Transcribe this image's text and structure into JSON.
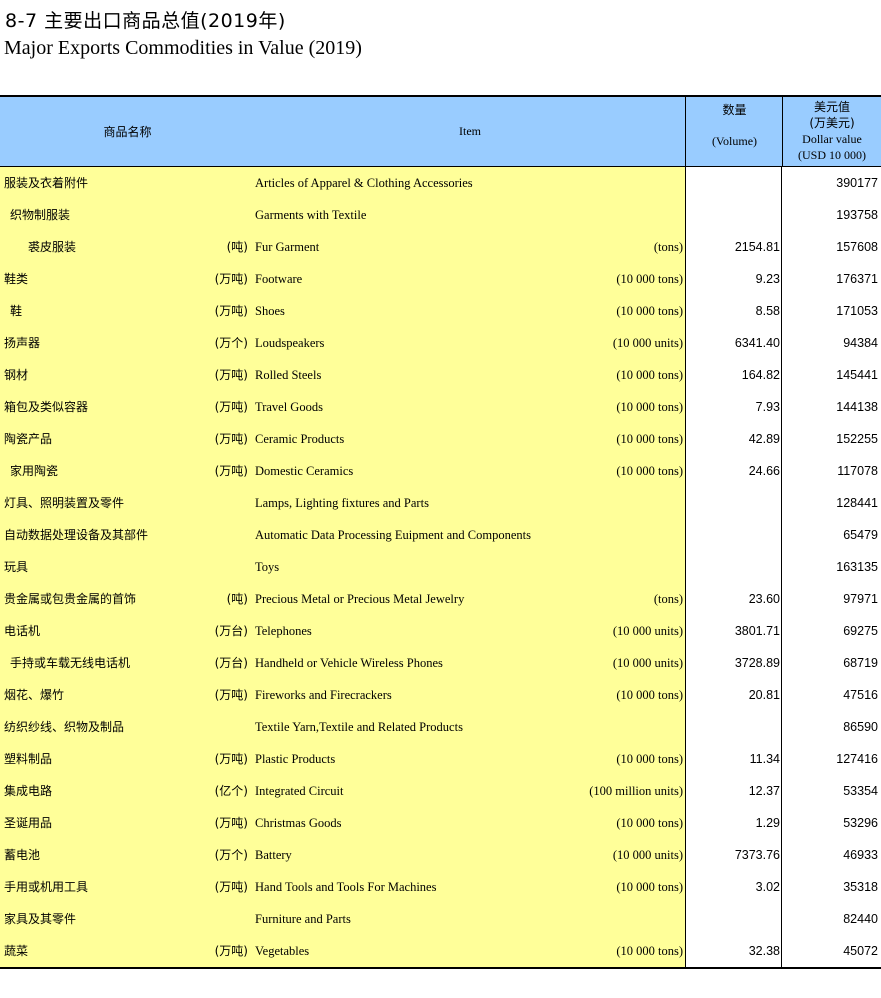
{
  "title_zh": "8-7  主要出口商品总值(2019年)",
  "title_en": "Major Exports Commodities in Value (2019)",
  "header": {
    "name_zh": "商品名称",
    "item_en": "Item",
    "volume_zh": "数量",
    "volume_en": "(Volume)",
    "value_zh_1": "美元值",
    "value_zh_2": "(万美元)",
    "value_en_1": "Dollar value",
    "value_en_2": "(USD 10 000)"
  },
  "rows": [
    {
      "name": "服装及衣着附件",
      "indent": 0,
      "unit_zh": "",
      "item": "Articles of Apparel & Clothing Accessories",
      "unit_en": "",
      "volume": "",
      "value": "390177"
    },
    {
      "name": "织物制服装",
      "indent": 1,
      "unit_zh": "",
      "item": "Garments with Textile",
      "unit_en": "",
      "volume": "",
      "value": "193758"
    },
    {
      "name": "裘皮服装",
      "indent": 2,
      "unit_zh": "(吨)",
      "item": "Fur Garment",
      "unit_en": "(tons)",
      "volume": "2154.81",
      "value": "157608"
    },
    {
      "name": "鞋类",
      "indent": 0,
      "unit_zh": "(万吨)",
      "item": "Footware",
      "unit_en": "(10 000 tons)",
      "volume": "9.23",
      "value": "176371"
    },
    {
      "name": "鞋",
      "indent": 1,
      "unit_zh": "(万吨)",
      "item": "Shoes",
      "unit_en": "(10 000 tons)",
      "volume": "8.58",
      "value": "171053"
    },
    {
      "name": "扬声器",
      "indent": 0,
      "unit_zh": "(万个)",
      "item": "Loudspeakers",
      "unit_en": "(10 000 units)",
      "volume": "6341.40",
      "value": "94384"
    },
    {
      "name": "钢材",
      "indent": 0,
      "unit_zh": "(万吨)",
      "item": "Rolled Steels",
      "unit_en": "(10 000 tons)",
      "volume": "164.82",
      "value": "145441"
    },
    {
      "name": "箱包及类似容器",
      "indent": 0,
      "unit_zh": "(万吨)",
      "item": "Travel Goods",
      "unit_en": "(10 000 tons)",
      "volume": "7.93",
      "value": "144138"
    },
    {
      "name": "陶瓷产品",
      "indent": 0,
      "unit_zh": "(万吨)",
      "item": "Ceramic Products",
      "unit_en": "(10 000 tons)",
      "volume": "42.89",
      "value": "152255"
    },
    {
      "name": "家用陶瓷",
      "indent": 1,
      "unit_zh": "(万吨)",
      "item": "Domestic Ceramics",
      "unit_en": "(10 000 tons)",
      "volume": "24.66",
      "value": "117078"
    },
    {
      "name": "灯具、照明装置及零件",
      "indent": 0,
      "unit_zh": "",
      "item": "Lamps, Lighting fixtures and Parts",
      "unit_en": "",
      "volume": "",
      "value": "128441"
    },
    {
      "name": "自动数据处理设备及其部件",
      "indent": 0,
      "unit_zh": "",
      "item": "Automatic Data Processing Euipment and Components",
      "unit_en": "",
      "volume": "",
      "value": "65479"
    },
    {
      "name": "玩具",
      "indent": 0,
      "unit_zh": "",
      "item": "Toys",
      "unit_en": "",
      "volume": "",
      "value": "163135"
    },
    {
      "name": "贵金属或包贵金属的首饰",
      "indent": 0,
      "unit_zh": "(吨)",
      "item": "Precious Metal or Precious Metal Jewelry",
      "unit_en": "(tons)",
      "volume": "23.60",
      "value": "97971"
    },
    {
      "name": "电话机",
      "indent": 0,
      "unit_zh": "(万台)",
      "item": "Telephones",
      "unit_en": "(10 000 units)",
      "volume": "3801.71",
      "value": "69275"
    },
    {
      "name": "手持或车载无线电话机",
      "indent": 1,
      "unit_zh": "(万台)",
      "item": "Handheld or Vehicle Wireless Phones",
      "unit_en": "(10 000 units)",
      "volume": "3728.89",
      "value": "68719"
    },
    {
      "name": "烟花、爆竹",
      "indent": 0,
      "unit_zh": "(万吨)",
      "item": "Fireworks and Firecrackers",
      "unit_en": "(10 000 tons)",
      "volume": "20.81",
      "value": "47516"
    },
    {
      "name": "纺织纱线、织物及制品",
      "indent": 0,
      "unit_zh": "",
      "item": "Textile Yarn,Textile and Related Products",
      "unit_en": "",
      "volume": "",
      "value": "86590"
    },
    {
      "name": "塑料制品",
      "indent": 0,
      "unit_zh": "(万吨)",
      "item": "Plastic Products",
      "unit_en": "(10 000 tons)",
      "volume": "11.34",
      "value": "127416"
    },
    {
      "name": "集成电路",
      "indent": 0,
      "unit_zh": "(亿个)",
      "item": "Integrated Circuit",
      "unit_en": "(100 million units)",
      "volume": "12.37",
      "value": "53354"
    },
    {
      "name": "圣诞用品",
      "indent": 0,
      "unit_zh": "(万吨)",
      "item": "Christmas Goods",
      "unit_en": "(10 000 tons)",
      "volume": "1.29",
      "value": "53296"
    },
    {
      "name": "蓄电池",
      "indent": 0,
      "unit_zh": "(万个)",
      "item": "Battery",
      "unit_en": "(10 000 units)",
      "volume": "7373.76",
      "value": "46933"
    },
    {
      "name": "手用或机用工具",
      "indent": 0,
      "unit_zh": "(万吨)",
      "item": "Hand Tools and Tools For Machines",
      "unit_en": "(10 000 tons)",
      "volume": "3.02",
      "value": "35318"
    },
    {
      "name": "家具及其零件",
      "indent": 0,
      "unit_zh": "",
      "item": "Furniture and Parts",
      "unit_en": "",
      "volume": "",
      "value": "82440"
    },
    {
      "name": "蔬菜",
      "indent": 0,
      "unit_zh": "(万吨)",
      "item": "Vegetables",
      "unit_en": "(10 000 tons)",
      "volume": "32.38",
      "value": "45072"
    }
  ]
}
